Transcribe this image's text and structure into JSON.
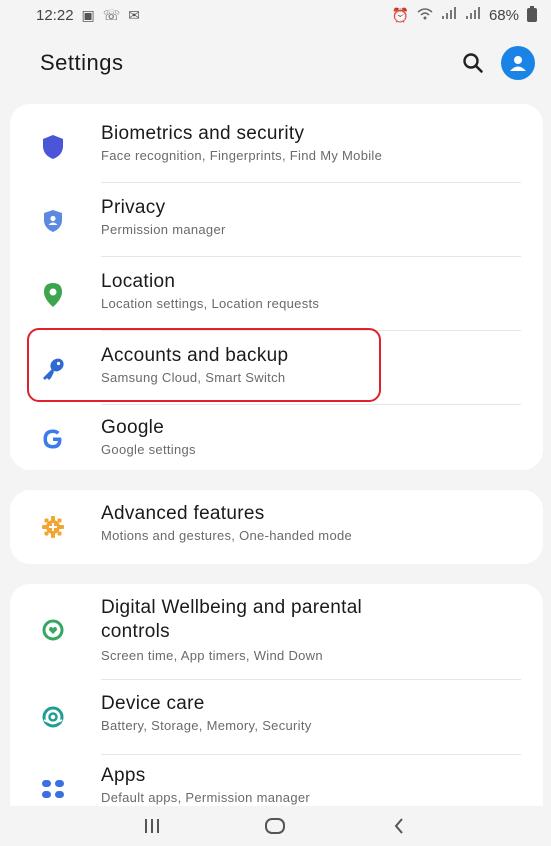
{
  "status_bar": {
    "time": "12:22",
    "battery": "68%"
  },
  "header": {
    "title": "Settings"
  },
  "groups": [
    {
      "items": [
        {
          "title": "Biometrics and security",
          "subtitle": "Face recognition, Fingerprints, Find My Mobile",
          "icon": "shield-icon"
        },
        {
          "title": "Privacy",
          "subtitle": "Permission manager",
          "icon": "privacy-icon"
        },
        {
          "title": "Location",
          "subtitle": "Location settings, Location requests",
          "icon": "location-pin-icon"
        },
        {
          "title": "Accounts and backup",
          "subtitle": "Samsung Cloud, Smart Switch",
          "icon": "key-icon"
        },
        {
          "title": "Google",
          "subtitle": "Google settings",
          "icon": "google-icon"
        }
      ]
    },
    {
      "items": [
        {
          "title": "Advanced features",
          "subtitle": "Motions and gestures, One-handed mode",
          "icon": "gear-plus-icon"
        }
      ]
    },
    {
      "items": [
        {
          "title": "Digital Wellbeing and parental",
          "title_line2": "controls",
          "subtitle": "Screen time, App timers, Wind Down",
          "icon": "wellbeing-icon"
        },
        {
          "title": "Device care",
          "subtitle": "Battery, Storage, Memory, Security",
          "icon": "device-care-icon"
        },
        {
          "title": "Apps",
          "subtitle": "Default apps, Permission manager",
          "icon": "apps-grid-icon"
        }
      ]
    }
  ],
  "colors": {
    "accent_blue": "#1a84e6",
    "highlight_red": "#e0202a",
    "privacy_blue": "#5b8ae0",
    "location_green": "#3ea54f",
    "key_blue": "#2f6ad4",
    "google_blue": "#3c7bea",
    "advanced_orange": "#f2a530",
    "wellbeing_green": "#35a760",
    "devicecare_teal": "#1e9e91",
    "apps_blue": "#3c6fe0"
  }
}
